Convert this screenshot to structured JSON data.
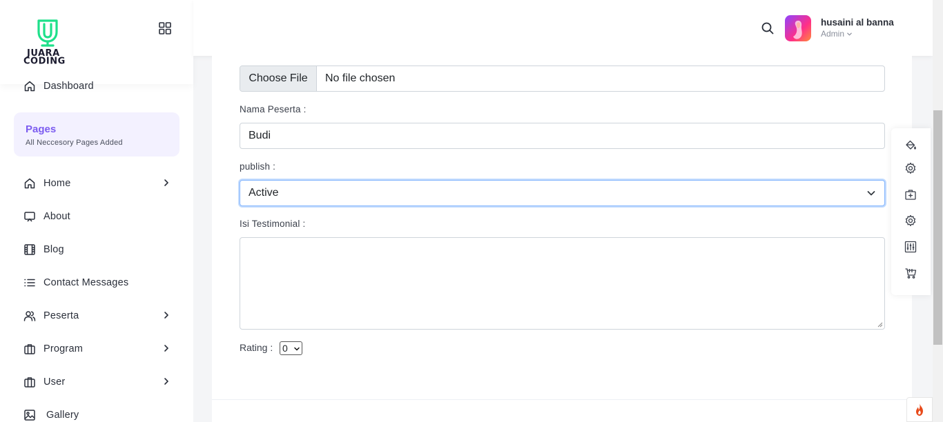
{
  "brand": {
    "logo_text_line1": "JUARA",
    "logo_text_line2": "CODING",
    "accent_color": "#1ee08a"
  },
  "sidebar": {
    "items": [
      {
        "label": "Dashboard",
        "icon": "home-icon",
        "has_children": false
      },
      {
        "label": "Home",
        "icon": "home-icon",
        "has_children": true
      },
      {
        "label": "About",
        "icon": "monitor-icon",
        "has_children": false
      },
      {
        "label": "Blog",
        "icon": "film-icon",
        "has_children": false
      },
      {
        "label": "Contact Messages",
        "icon": "list-icon",
        "has_children": false
      },
      {
        "label": "Peserta",
        "icon": "users-icon",
        "has_children": true
      },
      {
        "label": "Program",
        "icon": "briefcase-icon",
        "has_children": true
      },
      {
        "label": "User",
        "icon": "briefcase-icon",
        "has_children": true
      },
      {
        "label": "Gallery",
        "icon": "image-icon",
        "has_children": false
      }
    ],
    "pages_section": {
      "title": "Pages",
      "subtitle": "All Neccesory Pages Added",
      "accent_color": "#7c5cf0"
    }
  },
  "header": {
    "user": {
      "name": "husaini al banna",
      "role": "Admin"
    }
  },
  "form": {
    "file": {
      "button_label": "Choose File",
      "status": "No file chosen"
    },
    "nama_peserta": {
      "label": "Nama Peserta :",
      "value": "Budi"
    },
    "publish": {
      "label": "publish :",
      "selected": "Active"
    },
    "isi_testimonial": {
      "label": "Isi Testimonial :",
      "value": ""
    },
    "rating": {
      "label": "Rating :",
      "selected": "0"
    }
  },
  "float_toolbar": {
    "icons": [
      "paint-bucket-icon",
      "settings-icon",
      "add-box-icon",
      "settings-icon",
      "sliders-icon",
      "cart-icon"
    ]
  }
}
